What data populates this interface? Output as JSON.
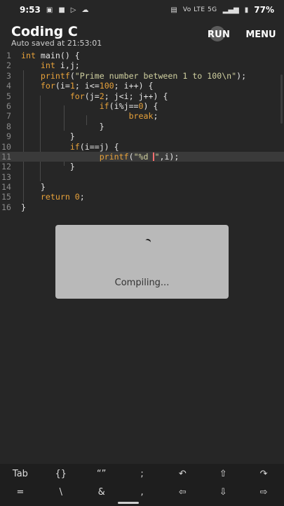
{
  "status_bar": {
    "time": "9:53",
    "network": "Vo LTE 5G",
    "battery": "77%",
    "icons": [
      "notification-icon",
      "video-icon",
      "play-store-icon",
      "cloud-icon",
      "cast-icon",
      "signal-icon",
      "battery-icon"
    ]
  },
  "app_bar": {
    "title": "Coding C",
    "subtitle": "Auto saved at 21:53:01",
    "run_label": "RUN",
    "menu_label": "MENU"
  },
  "editor": {
    "lines": [
      {
        "num": "1",
        "tokens": [
          {
            "t": "int",
            "c": "kw"
          },
          {
            "t": " main() {",
            "c": "pl"
          }
        ]
      },
      {
        "num": "2",
        "tokens": [
          {
            "t": "    ",
            "c": "pl"
          },
          {
            "t": "int",
            "c": "kw"
          },
          {
            "t": " i,j;",
            "c": "pl"
          }
        ]
      },
      {
        "num": "3",
        "tokens": [
          {
            "t": "    ",
            "c": "pl"
          },
          {
            "t": "printf",
            "c": "kw"
          },
          {
            "t": "(",
            "c": "pl"
          },
          {
            "t": "\"Prime number between 1 to 100\\n\"",
            "c": "str"
          },
          {
            "t": ");",
            "c": "pl"
          }
        ]
      },
      {
        "num": "4",
        "tokens": [
          {
            "t": "    ",
            "c": "pl"
          },
          {
            "t": "for",
            "c": "kw"
          },
          {
            "t": "(i=",
            "c": "pl"
          },
          {
            "t": "1",
            "c": "num"
          },
          {
            "t": "; i<=",
            "c": "pl"
          },
          {
            "t": "100",
            "c": "num"
          },
          {
            "t": "; i++) {",
            "c": "pl"
          }
        ]
      },
      {
        "num": "5",
        "tokens": [
          {
            "t": "          ",
            "c": "pl"
          },
          {
            "t": "for",
            "c": "kw"
          },
          {
            "t": "(j=",
            "c": "pl"
          },
          {
            "t": "2",
            "c": "num"
          },
          {
            "t": "; j<i; j++) {",
            "c": "pl"
          }
        ]
      },
      {
        "num": "6",
        "tokens": [
          {
            "t": "                ",
            "c": "pl"
          },
          {
            "t": "if",
            "c": "kw"
          },
          {
            "t": "(i%j==",
            "c": "pl"
          },
          {
            "t": "0",
            "c": "num"
          },
          {
            "t": ") {",
            "c": "pl"
          }
        ]
      },
      {
        "num": "7",
        "tokens": [
          {
            "t": "                      ",
            "c": "pl"
          },
          {
            "t": "break",
            "c": "kw"
          },
          {
            "t": ";",
            "c": "pl"
          }
        ]
      },
      {
        "num": "8",
        "tokens": [
          {
            "t": "                }",
            "c": "pl"
          }
        ]
      },
      {
        "num": "9",
        "tokens": [
          {
            "t": "          }",
            "c": "pl"
          }
        ]
      },
      {
        "num": "10",
        "tokens": [
          {
            "t": "          ",
            "c": "pl"
          },
          {
            "t": "if",
            "c": "kw"
          },
          {
            "t": "(i==j) {",
            "c": "pl"
          }
        ]
      },
      {
        "num": "11",
        "current": true,
        "tokens": [
          {
            "t": "                ",
            "c": "pl"
          },
          {
            "t": "printf",
            "c": "kw"
          },
          {
            "t": "(",
            "c": "pl"
          },
          {
            "t": "\"%d ",
            "c": "str"
          },
          {
            "cursor": true
          },
          {
            "t": "\"",
            "c": "str"
          },
          {
            "t": ",i);",
            "c": "pl"
          }
        ]
      },
      {
        "num": "12",
        "tokens": [
          {
            "t": "          }",
            "c": "pl"
          }
        ]
      },
      {
        "num": "13",
        "tokens": []
      },
      {
        "num": "14",
        "tokens": [
          {
            "t": "    }",
            "c": "pl"
          }
        ]
      },
      {
        "num": "15",
        "tokens": [
          {
            "t": "    ",
            "c": "pl"
          },
          {
            "t": "return",
            "c": "kw"
          },
          {
            "t": " ",
            "c": "pl"
          },
          {
            "t": "0",
            "c": "num"
          },
          {
            "t": ";",
            "c": "pl"
          }
        ]
      },
      {
        "num": "16",
        "tokens": [
          {
            "t": "}",
            "c": "pl"
          }
        ]
      }
    ]
  },
  "dialog": {
    "message": "Compiling..."
  },
  "keyboard": {
    "row1": [
      "Tab",
      "{}",
      "“”",
      ";",
      "↶",
      "⇧",
      "↷"
    ],
    "row2": [
      "=",
      "\\",
      "&",
      ",",
      "⇦",
      "⇩",
      "⇨"
    ]
  },
  "colors": {
    "background": "#262626",
    "keyword": "#e8a23a",
    "string": "#d0d0a0",
    "dialog": "#b9b9b9"
  }
}
